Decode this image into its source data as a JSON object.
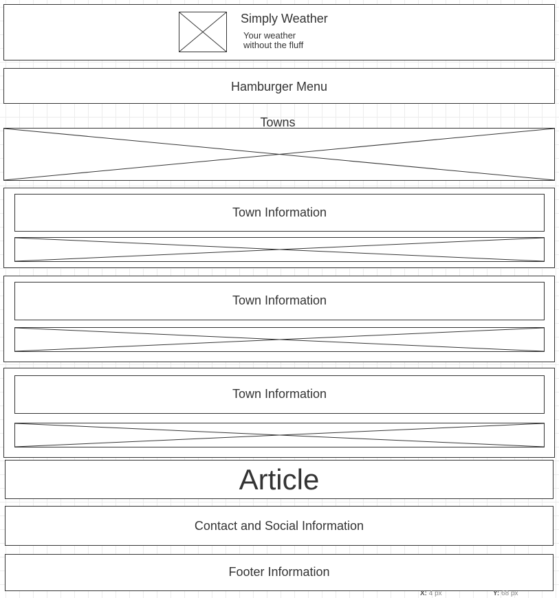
{
  "header": {
    "title": "Simply Weather",
    "tagline_line1": "Your weather",
    "tagline_line2": "without the fluff",
    "logo_icon": "image-placeholder-icon"
  },
  "nav": {
    "menu_label": "Hamburger Menu"
  },
  "towns": {
    "heading": "Towns",
    "image_icon": "image-placeholder-icon",
    "cards": [
      {
        "info_label": "Town Information",
        "image_icon": "image-placeholder-icon"
      },
      {
        "info_label": "Town Information",
        "image_icon": "image-placeholder-icon"
      },
      {
        "info_label": "Town Information",
        "image_icon": "image-placeholder-icon"
      }
    ]
  },
  "article": {
    "label": "Article"
  },
  "contact": {
    "label": "Contact and Social Information"
  },
  "footer": {
    "label": "Footer Information"
  },
  "status": {
    "x_label": "X:",
    "x_value": "4 px",
    "y_label": "Y:",
    "y_value": "68 px"
  },
  "colors": {
    "stroke": "#333333",
    "grid": "#ececec",
    "background": "#ffffff"
  }
}
